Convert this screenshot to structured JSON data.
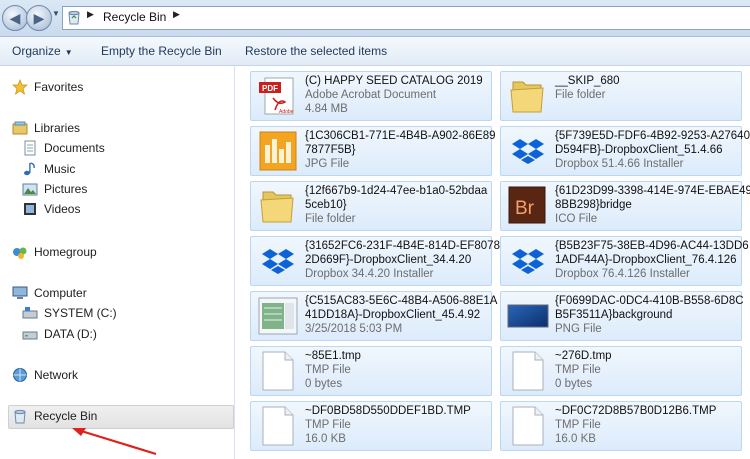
{
  "address": {
    "crumb": "Recycle Bin"
  },
  "toolbar": {
    "organize": "Organize",
    "empty": "Empty the Recycle Bin",
    "restore": "Restore the selected items"
  },
  "nav": {
    "favorites": "Favorites",
    "libraries": "Libraries",
    "documents": "Documents",
    "music": "Music",
    "pictures": "Pictures",
    "videos": "Videos",
    "homegroup": "Homegroup",
    "computer": "Computer",
    "system": "SYSTEM (C:)",
    "data": "DATA (D:)",
    "network": "Network",
    "recycle": "Recycle Bin"
  },
  "files": [
    {
      "name1": "(C) HAPPY SEED CATALOG 2019",
      "name2": "",
      "type": "Adobe Acrobat Document",
      "detail": "4.84 MB",
      "icon": "pdf-icon"
    },
    {
      "name1": "__SKIP_680",
      "name2": "",
      "type": "File folder",
      "detail": "",
      "icon": "folder-icon"
    },
    {
      "name1": "{1C306CB1-771E-4B4B-A902-86E89",
      "name2": "7877F5B}",
      "type": "JPG File",
      "detail": "",
      "icon": "jpg-icon"
    },
    {
      "name1": "{5F739E5D-FDF6-4B92-9253-A27640",
      "name2": "D594FB}-DropboxClient_51.4.66",
      "type": "Dropbox 51.4.66 Installer",
      "detail": "",
      "icon": "dropbox-icon"
    },
    {
      "name1": "{12f667b9-1d24-47ee-b1a0-52bdaa",
      "name2": "5ceb10}",
      "type": "File folder",
      "detail": "",
      "icon": "folder-icon"
    },
    {
      "name1": "{61D23D99-3398-414E-974E-EBAE49",
      "name2": "8BB298}bridge",
      "type": "ICO File",
      "detail": "",
      "icon": "bridge-icon"
    },
    {
      "name1": "{31652FC6-231F-4B4E-814D-EF8078",
      "name2": "2D669F}-DropboxClient_34.4.20",
      "type": "Dropbox 34.4.20 Installer",
      "detail": "",
      "icon": "dropbox-icon"
    },
    {
      "name1": "{B5B23F75-38EB-4D96-AC44-13DD6",
      "name2": "1ADF44A}-DropboxClient_76.4.126",
      "type": "Dropbox 76.4.126 Installer",
      "detail": "",
      "icon": "dropbox-icon"
    },
    {
      "name1": "{C515AC83-5E6C-48B4-A506-88E1A",
      "name2": "41DD18A}-DropboxClient_45.4.92",
      "type": "3/25/2018 5:03 PM",
      "detail": "",
      "icon": "installer-icon"
    },
    {
      "name1": "{F0699DAC-0DC4-410B-B558-6D8C",
      "name2": "B5F3511A}background",
      "type": "PNG File",
      "detail": "",
      "icon": "png-icon"
    },
    {
      "name1": "~85E1.tmp",
      "name2": "",
      "type": "TMP File",
      "detail": "0 bytes",
      "icon": "blank-file-icon"
    },
    {
      "name1": "~276D.tmp",
      "name2": "",
      "type": "TMP File",
      "detail": "0 bytes",
      "icon": "blank-file-icon"
    },
    {
      "name1": "~DF0BD58D550DDEF1BD.TMP",
      "name2": "",
      "type": "TMP File",
      "detail": "16.0 KB",
      "icon": "blank-file-icon"
    },
    {
      "name1": "~DF0C72D8B57B0D12B6.TMP",
      "name2": "",
      "type": "TMP File",
      "detail": "16.0 KB",
      "icon": "blank-file-icon"
    }
  ]
}
